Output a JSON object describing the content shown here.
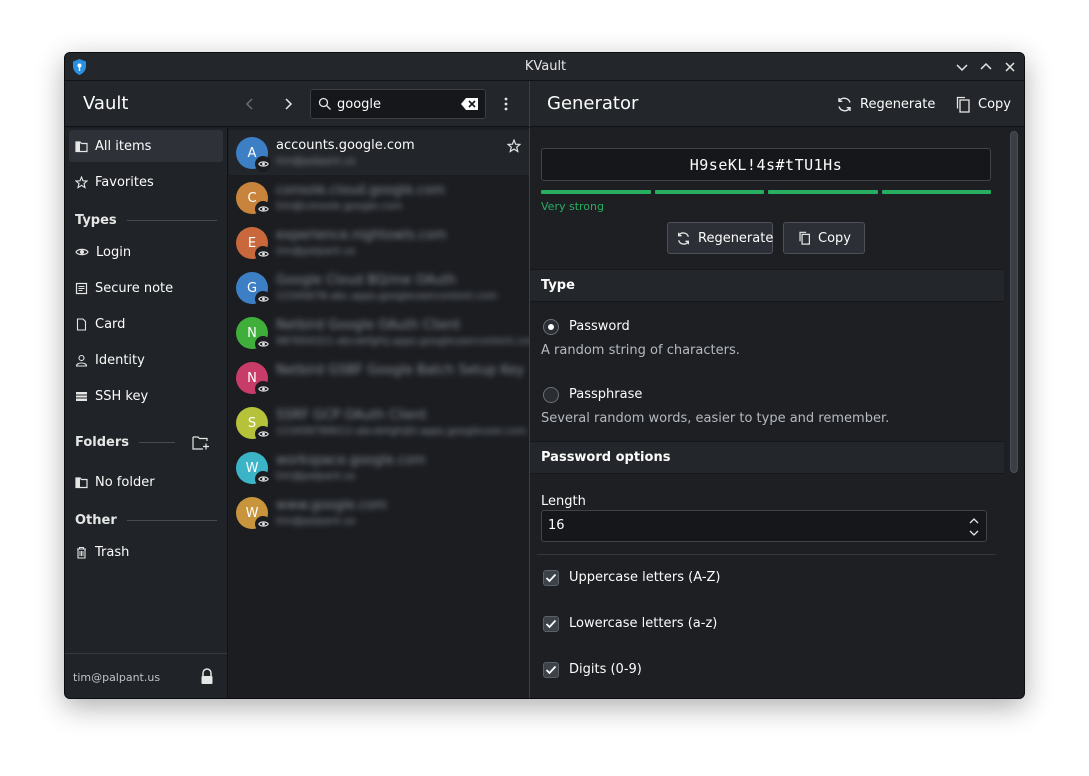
{
  "window": {
    "title": "KVault"
  },
  "header": {
    "vault_title": "Vault",
    "search": {
      "value": "google",
      "placeholder": "Search"
    },
    "generator_title": "Generator",
    "regenerate_label": "Regenerate",
    "copy_label": "Copy"
  },
  "sidebar": {
    "items": [
      {
        "label": "All items",
        "icon": "folder-icon"
      },
      {
        "label": "Favorites",
        "icon": "star-icon"
      }
    ],
    "types_heading": "Types",
    "types": [
      {
        "label": "Login",
        "icon": "eye-icon"
      },
      {
        "label": "Secure note",
        "icon": "note-icon"
      },
      {
        "label": "Card",
        "icon": "document-icon"
      },
      {
        "label": "Identity",
        "icon": "person-icon"
      },
      {
        "label": "SSH key",
        "icon": "key-icon"
      }
    ],
    "folders_heading": "Folders",
    "folders": [
      {
        "label": "No folder",
        "icon": "folder-icon"
      }
    ],
    "other_heading": "Other",
    "other": [
      {
        "label": "Trash",
        "icon": "trash-icon"
      }
    ],
    "footer_email": "tim@palpant.us"
  },
  "list": {
    "items": [
      {
        "initial": "A",
        "title": "accounts.google.com",
        "subtitle": "tim@palpant.us",
        "color": "#3d7fc4",
        "blurred": false
      },
      {
        "initial": "C",
        "title": "console.cloud.google.com",
        "subtitle": "tim@console.google.com",
        "color": "#c8843c",
        "blurred": true
      },
      {
        "initial": "E",
        "title": "experience.nightowls.com",
        "subtitle": "tim@palpant.us",
        "color": "#c8683c",
        "blurred": true
      },
      {
        "initial": "G",
        "title": "Google Cloud BQ/me OAuth",
        "subtitle": "12345678-abc.apps.googleusercontent.com",
        "color": "#3d7fc4",
        "blurred": true
      },
      {
        "initial": "N",
        "title": "Netbird Google OAuth Client",
        "subtitle": "987654321-abcdefghij.apps.googleusercontent.com",
        "color": "#3fae3b",
        "blurred": true
      },
      {
        "initial": "N",
        "title": "Netbird GSBF Google Batch Setup Key",
        "subtitle": "",
        "color": "#c83c6a",
        "blurred": true
      },
      {
        "initial": "S",
        "title": "SSRF GCP OAuth Client",
        "subtitle": "123456789012-abcdefghijkl.apps.googleuser.com",
        "color": "#b7c23b",
        "blurred": true
      },
      {
        "initial": "W",
        "title": "workspace.google.com",
        "subtitle": "tim@palpant.us",
        "color": "#3cb4c8",
        "blurred": true
      },
      {
        "initial": "W",
        "title": "www.google.com",
        "subtitle": "tim@palpant.us",
        "color": "#c8943c",
        "blurred": true
      }
    ]
  },
  "generator": {
    "password": "H9seKL!4s#tTU1Hs",
    "strength_label": "Very strong",
    "strength_fraction": 1.0,
    "regenerate_label": "Regenerate",
    "copy_label": "Copy",
    "type_heading": "Type",
    "types": [
      {
        "label": "Password",
        "description": "A random string of characters.",
        "selected": true
      },
      {
        "label": "Passphrase",
        "description": "Several random words, easier to type and remember.",
        "selected": false
      }
    ],
    "options_heading": "Password options",
    "length_label": "Length",
    "length_value": "16",
    "checkboxes": [
      {
        "label": "Uppercase letters (A-Z)",
        "checked": true
      },
      {
        "label": "Lowercase letters (a-z)",
        "checked": true
      },
      {
        "label": "Digits (0-9)",
        "checked": true
      }
    ]
  },
  "colors": {
    "accent": "#27ae60",
    "window_bg": "#1d1f23",
    "header_bg": "#23262b"
  }
}
